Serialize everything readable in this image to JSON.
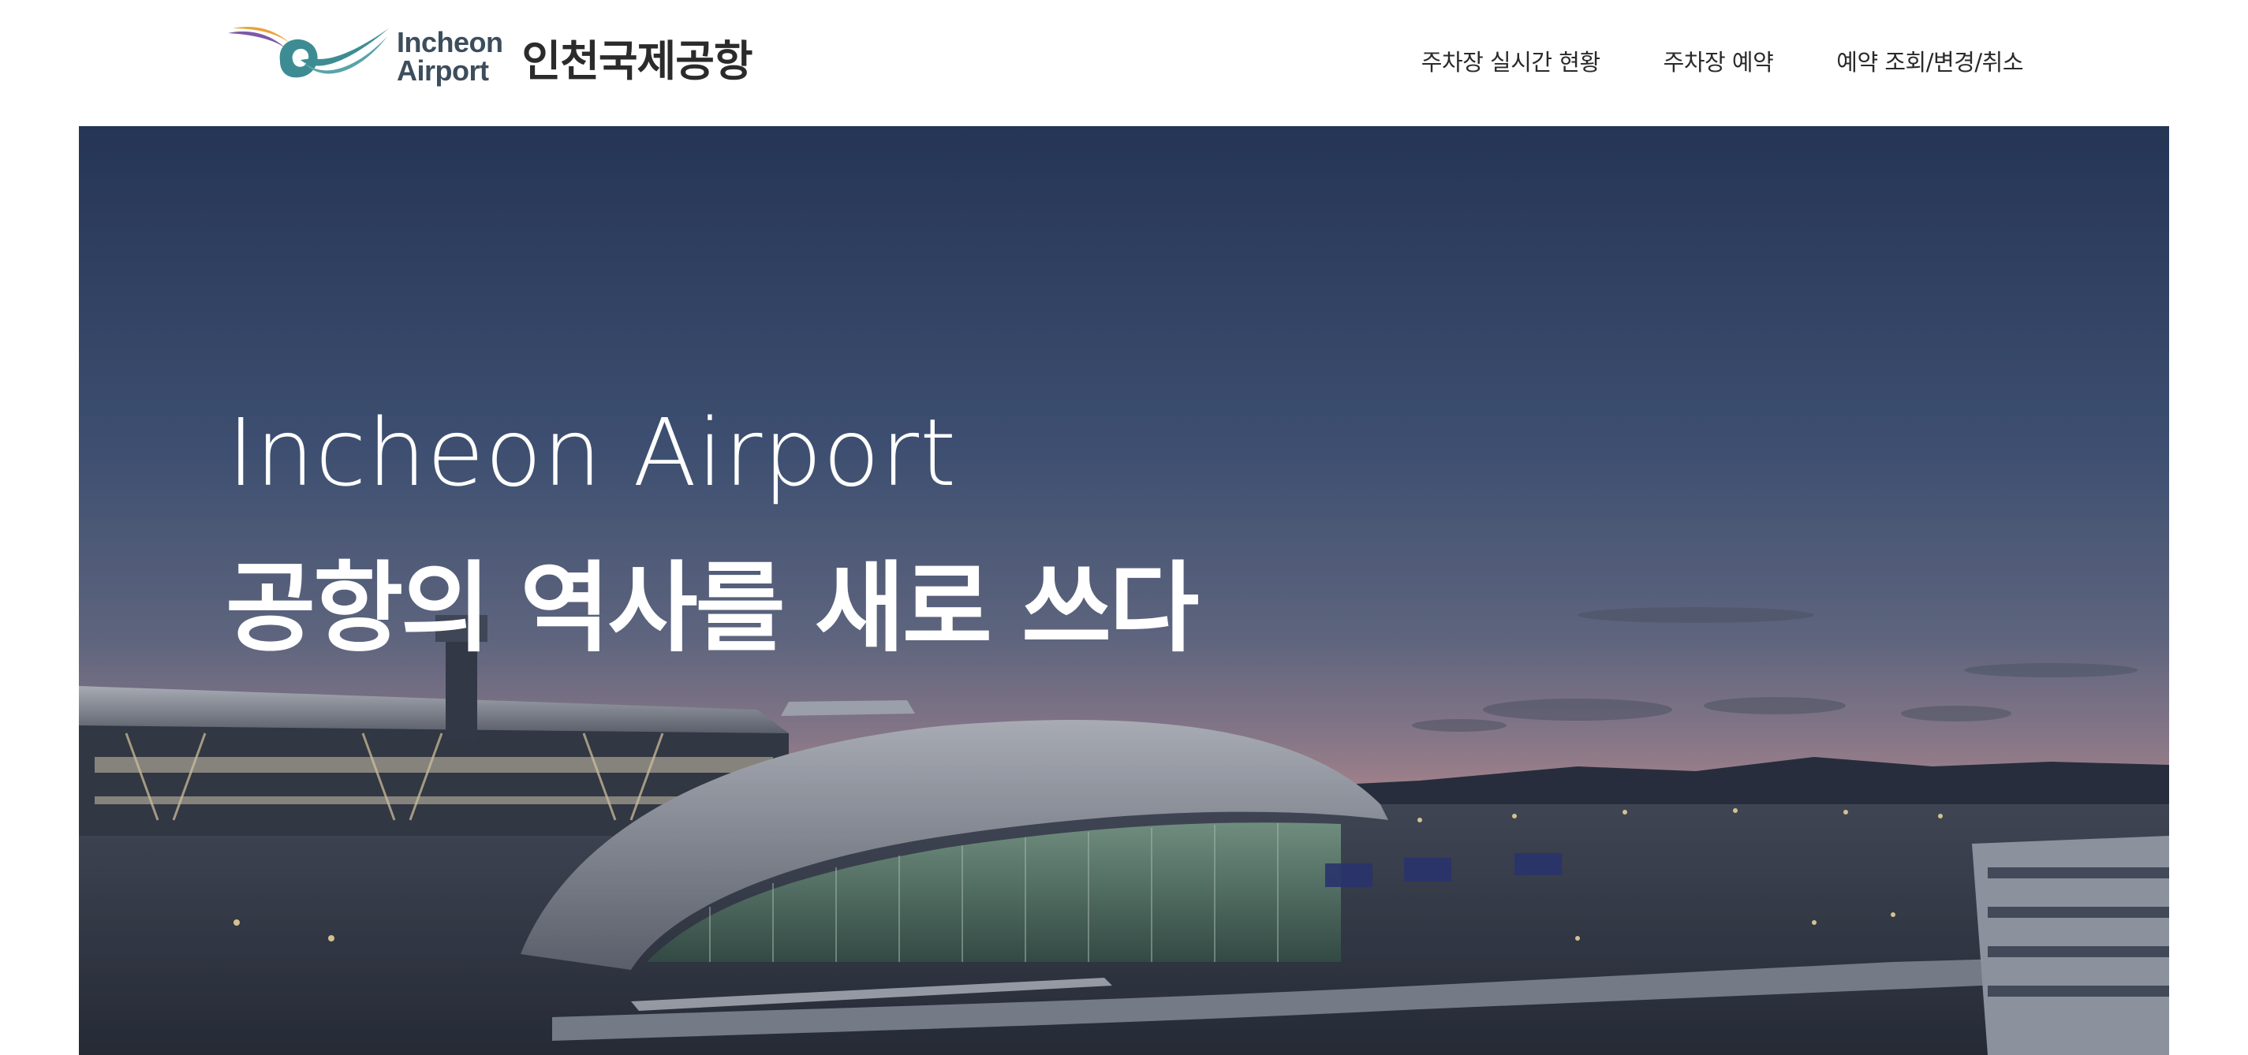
{
  "header": {
    "logo_en_line1": "Incheon",
    "logo_en_line2": "Airport",
    "logo_ko": "인천국제공항",
    "nav": [
      {
        "label": "주차장 실시간 현황"
      },
      {
        "label": "주차장 예약"
      },
      {
        "label": "예약 조회/변경/취소"
      }
    ]
  },
  "hero": {
    "title_en": "Incheon Airport",
    "title_ko": "공항의 역사를 새로 쓰다"
  },
  "colors": {
    "logo_teal": "#3d8c94",
    "logo_orange": "#e8a33a",
    "logo_purple": "#7a5aa8",
    "nav_text": "#2a2a2a",
    "hero_sky_top": "#2c3e60",
    "hero_sky_dusk": "#b38e98"
  }
}
